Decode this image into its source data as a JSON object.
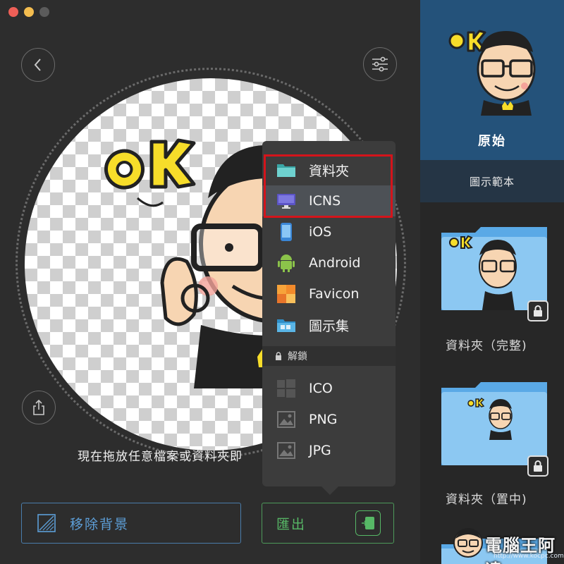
{
  "window": {
    "traffic_lights": [
      "close",
      "minimize",
      "zoom"
    ]
  },
  "toolbar": {
    "back_icon": "chevron-left-icon",
    "settings_icon": "sliders-icon",
    "share_icon": "share-icon"
  },
  "canvas": {
    "sticker_text": "OK",
    "drop_hint": "現在拖放任意檔案或資料夾即"
  },
  "bottom_bar": {
    "remove_bg_label": "移除背景",
    "export_label": "匯出"
  },
  "export_menu": {
    "items": [
      {
        "label": "資料夾",
        "icon": "folder-icon"
      },
      {
        "label": "ICNS",
        "icon": "monitor-icon",
        "selected": true
      },
      {
        "label": "iOS",
        "icon": "iphone-icon"
      },
      {
        "label": "Android",
        "icon": "android-icon"
      },
      {
        "label": "Favicon",
        "icon": "favicon-icon"
      },
      {
        "label": "圖示集",
        "icon": "iconset-folder-icon"
      }
    ],
    "locked_section_label": "解鎖",
    "locked_items": [
      {
        "label": "ICO",
        "icon": "windows-icon"
      },
      {
        "label": "PNG",
        "icon": "image-icon"
      },
      {
        "label": "JPG",
        "icon": "image-icon"
      }
    ]
  },
  "sidebar": {
    "original_label": "原始",
    "templates_header": "圖示範本",
    "templates": [
      {
        "caption": "資料夾（完整)",
        "locked": true
      },
      {
        "caption": "資料夾（置中)",
        "locked": true
      }
    ]
  },
  "watermark": {
    "text": "電腦王阿達",
    "url": "http://www.kocpc.com.tw"
  },
  "colors": {
    "accent_blue": "#24527a",
    "export_green": "#57b866",
    "remove_bg_blue": "#5d9fd8",
    "highlight_red": "#d4141b"
  }
}
